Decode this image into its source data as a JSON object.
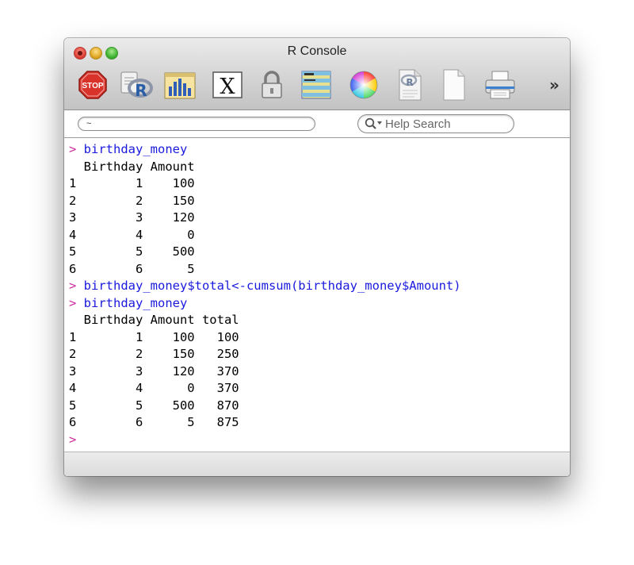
{
  "window": {
    "title": "R Console",
    "traffic_lights": [
      "close",
      "minimize",
      "zoom"
    ]
  },
  "toolbar": {
    "buttons": [
      {
        "name": "stop",
        "icon": "stop-sign-icon",
        "label": "STOP"
      },
      {
        "name": "source",
        "icon": "r-source-script-icon",
        "label": ""
      },
      {
        "name": "quartz",
        "icon": "bar-chart-window-icon",
        "label": ""
      },
      {
        "name": "x11",
        "icon": "x-window-icon",
        "label": "X"
      },
      {
        "name": "authorize",
        "icon": "padlock-icon",
        "label": ""
      },
      {
        "name": "history",
        "icon": "striped-history-icon",
        "label": ""
      },
      {
        "name": "colors",
        "icon": "color-wheel-icon",
        "label": ""
      },
      {
        "name": "open-doc",
        "icon": "r-document-icon",
        "label": ""
      },
      {
        "name": "new-doc",
        "icon": "blank-document-icon",
        "label": ""
      },
      {
        "name": "print",
        "icon": "printer-icon",
        "label": ""
      }
    ],
    "overflow_label": "»"
  },
  "searchbar": {
    "working_dir": "~",
    "help_placeholder": "Help Search"
  },
  "console": {
    "prompt_symbol": ">",
    "lines": [
      {
        "type": "cmd",
        "text": "birthday_money"
      },
      {
        "type": "out",
        "text": "  Birthday Amount"
      },
      {
        "type": "out",
        "text": "1        1    100"
      },
      {
        "type": "out",
        "text": "2        2    150"
      },
      {
        "type": "out",
        "text": "3        3    120"
      },
      {
        "type": "out",
        "text": "4        4      0"
      },
      {
        "type": "out",
        "text": "5        5    500"
      },
      {
        "type": "out",
        "text": "6        6      5"
      },
      {
        "type": "cmd",
        "text": "birthday_money$total<-cumsum(birthday_money$Amount)"
      },
      {
        "type": "cmd",
        "text": "birthday_money"
      },
      {
        "type": "out",
        "text": "  Birthday Amount total"
      },
      {
        "type": "out",
        "text": "1        1    100   100"
      },
      {
        "type": "out",
        "text": "2        2    150   250"
      },
      {
        "type": "out",
        "text": "3        3    120   370"
      },
      {
        "type": "out",
        "text": "4        4      0   370"
      },
      {
        "type": "out",
        "text": "5        5    500   870"
      },
      {
        "type": "out",
        "text": "6        6      5   875"
      },
      {
        "type": "prompt",
        "text": ""
      }
    ]
  },
  "colors": {
    "prompt": "#cc2a9a",
    "command": "#1a1add",
    "output": "#000000"
  }
}
